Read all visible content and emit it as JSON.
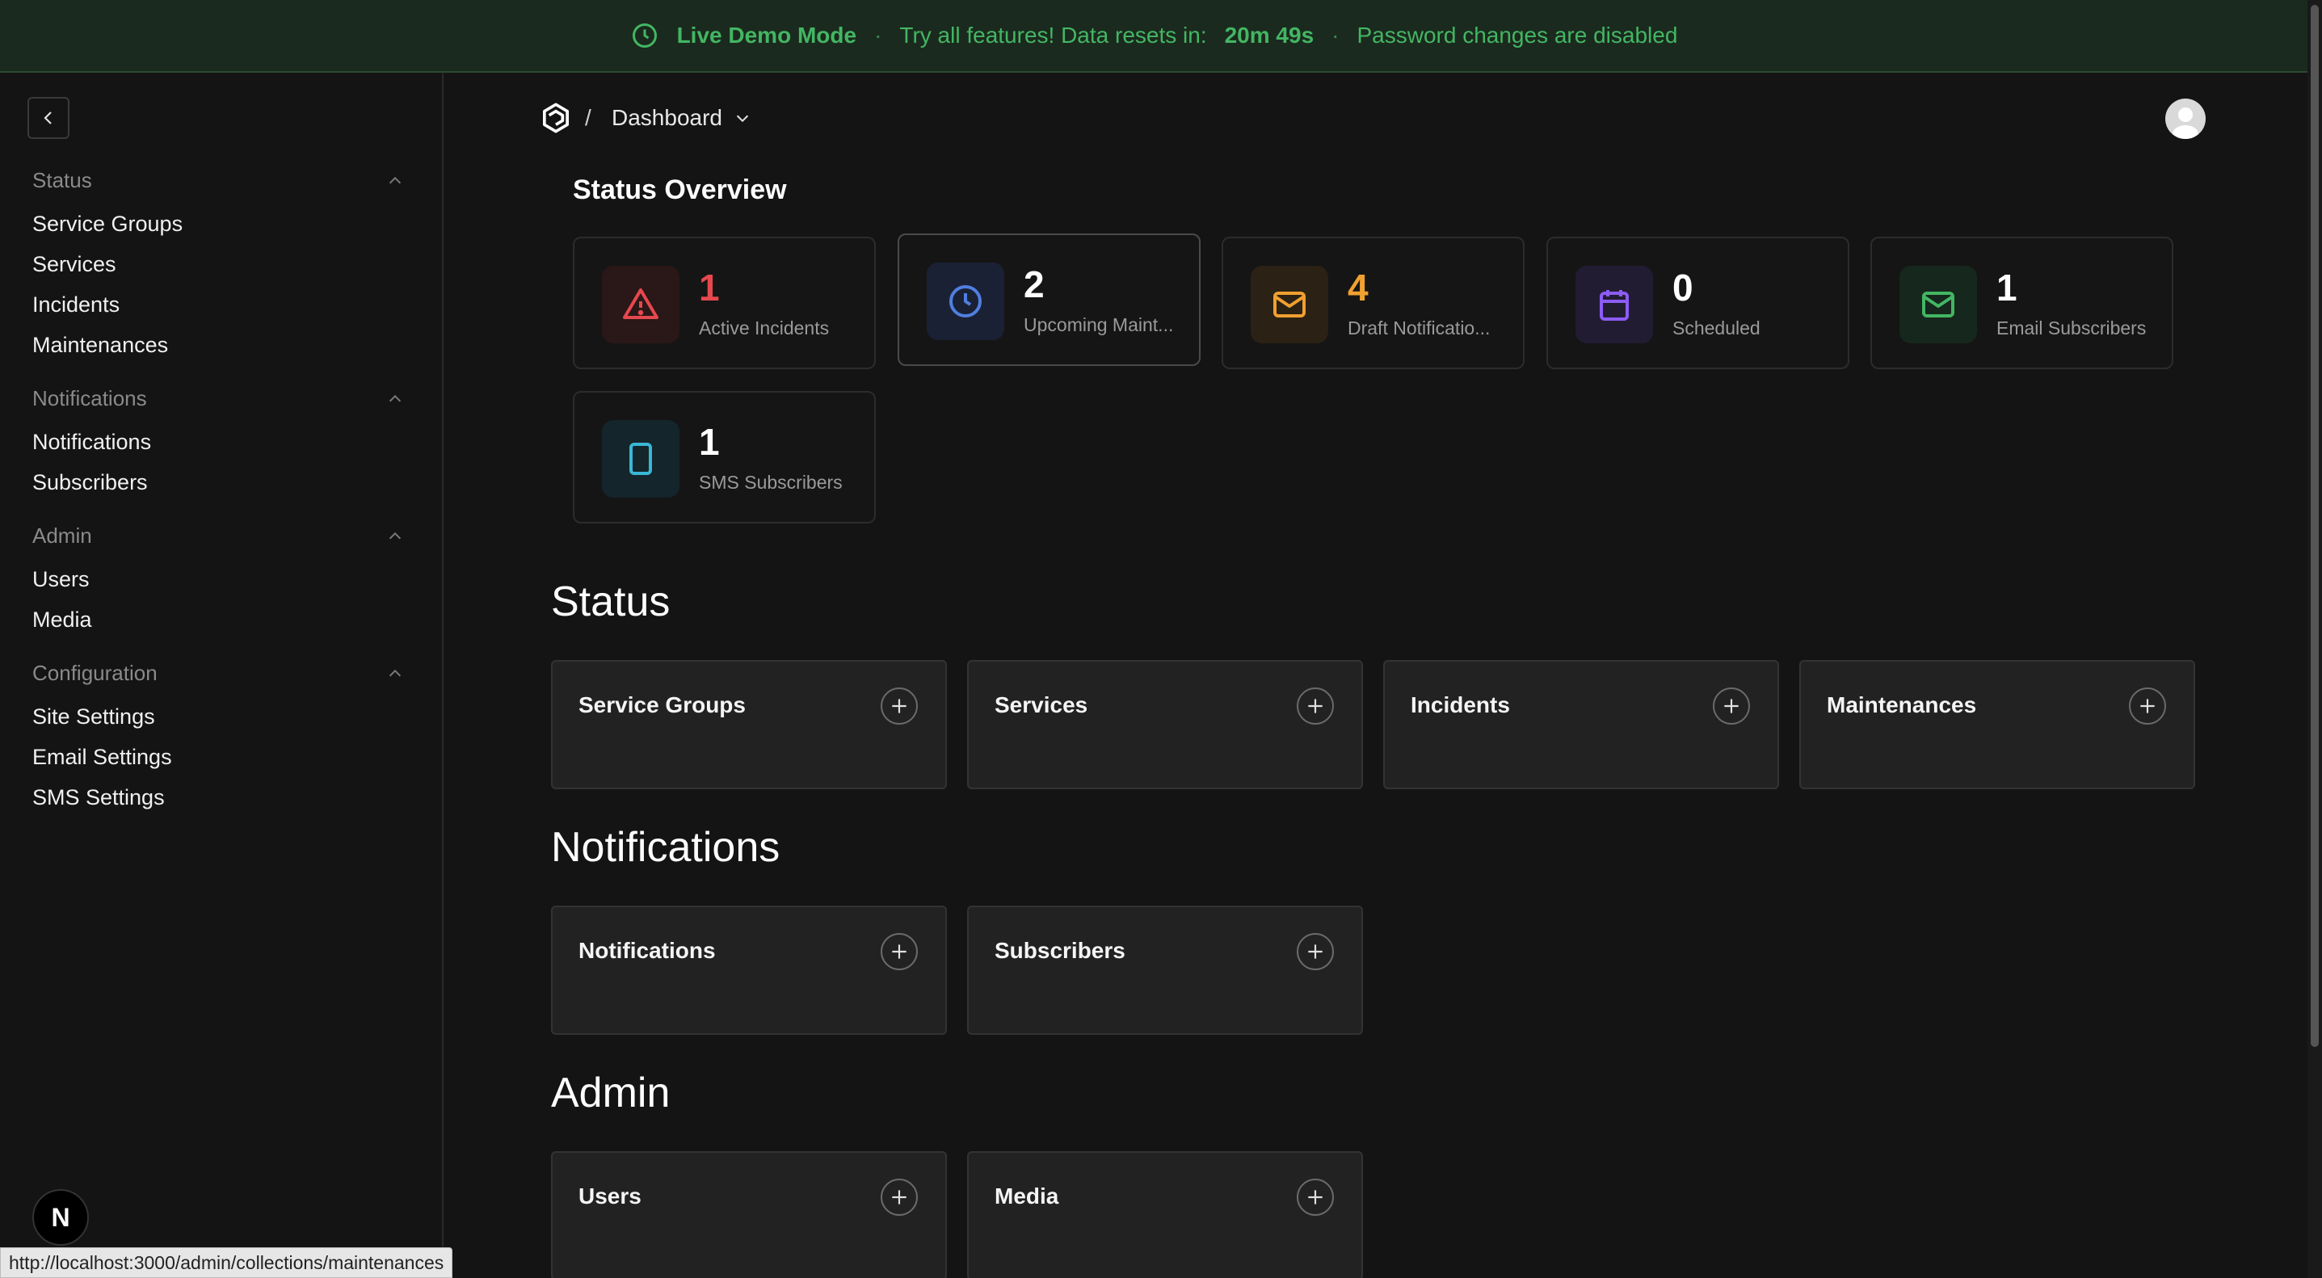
{
  "banner": {
    "mode": "Live Demo Mode",
    "sep": "·",
    "message": "Try all features! Data resets in:",
    "countdown": "20m 49s",
    "note": "Password changes are disabled"
  },
  "sidebar": {
    "groups": [
      {
        "label": "Status",
        "items": [
          "Service Groups",
          "Services",
          "Incidents",
          "Maintenances"
        ]
      },
      {
        "label": "Notifications",
        "items": [
          "Notifications",
          "Subscribers"
        ]
      },
      {
        "label": "Admin",
        "items": [
          "Users",
          "Media"
        ]
      },
      {
        "label": "Configuration",
        "items": [
          "Site Settings",
          "Email Settings",
          "SMS Settings"
        ]
      }
    ],
    "badge": "N"
  },
  "header": {
    "separator": "/",
    "breadcrumb": "Dashboard"
  },
  "overview": {
    "title": "Status Overview",
    "stats": [
      {
        "value": "1",
        "label": "Active Incidents",
        "color": "#e5484d",
        "icon": "alert-triangle-icon"
      },
      {
        "value": "2",
        "label": "Upcoming Maint...",
        "color": "#ffffff",
        "icon": "clock-icon"
      },
      {
        "value": "4",
        "label": "Draft Notificatio...",
        "color": "#f0a030",
        "icon": "mail-icon"
      },
      {
        "value": "0",
        "label": "Scheduled",
        "color": "#ffffff",
        "icon": "calendar-icon"
      },
      {
        "value": "1",
        "label": "Email Subscribers",
        "color": "#ffffff",
        "icon": "mail-icon"
      },
      {
        "value": "1",
        "label": "SMS Subscribers",
        "color": "#ffffff",
        "icon": "smartphone-icon"
      }
    ]
  },
  "sections": [
    {
      "title": "Status",
      "collections": [
        "Service Groups",
        "Services",
        "Incidents",
        "Maintenances"
      ]
    },
    {
      "title": "Notifications",
      "collections": [
        "Notifications",
        "Subscribers"
      ]
    },
    {
      "title": "Admin",
      "collections": [
        "Users",
        "Media"
      ]
    }
  ],
  "status_bar": {
    "url": "http://localhost:3000/admin/collections/maintenances"
  },
  "colors": {
    "accent_green": "#43b663",
    "danger": "#e5484d",
    "warning": "#f0a030",
    "info_blue": "#4f7fe0",
    "purple": "#8b5cf6",
    "teal": "#3ab7d6"
  }
}
